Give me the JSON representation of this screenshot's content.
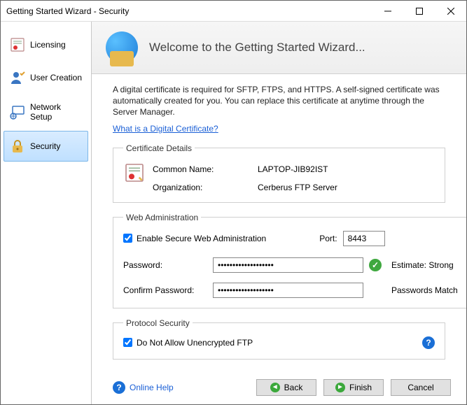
{
  "window": {
    "title": "Getting Started Wizard - Security"
  },
  "sidebar": {
    "items": [
      {
        "label": "Licensing"
      },
      {
        "label": "User Creation"
      },
      {
        "label": "Network Setup"
      },
      {
        "label": "Security"
      }
    ]
  },
  "header": {
    "title": "Welcome to the Getting Started Wizard..."
  },
  "intro": {
    "text": "A digital certificate is required for SFTP, FTPS, and HTTPS.  A self-signed certificate was automatically created for you.  You can replace this certificate at anytime through the Server Manager.",
    "link": "What is a Digital Certificate?"
  },
  "cert": {
    "legend": "Certificate Details",
    "common_name_label": "Common Name:",
    "common_name_value": "LAPTOP-JIB92IST",
    "org_label": "Organization:",
    "org_value": "Cerberus FTP Server"
  },
  "webadmin": {
    "legend": "Web Administration",
    "enable_label": "Enable Secure Web Administration",
    "port_label": "Port:",
    "port_value": "8443",
    "password_label": "Password:",
    "password_value": "•••••••••••••••••••",
    "confirm_label": "Confirm Password:",
    "confirm_value": "•••••••••••••••••••",
    "estimate_label": "Estimate: Strong",
    "match_label": "Passwords Match"
  },
  "protocol": {
    "legend": "Protocol Security",
    "no_unencrypted_label": "Do Not Allow Unencrypted FTP"
  },
  "footer": {
    "online_help": "Online Help",
    "back": "Back",
    "finish": "Finish",
    "cancel": "Cancel"
  }
}
